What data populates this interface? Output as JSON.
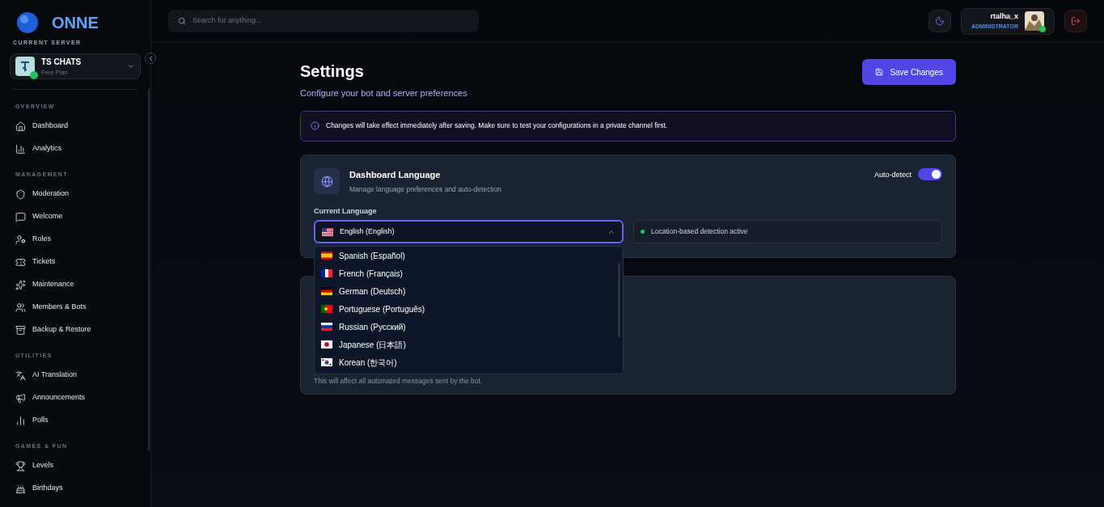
{
  "brand": {
    "name": "ONNE"
  },
  "server": {
    "section_label": "CURRENT SERVER",
    "name": "TS CHATS",
    "plan": "Free Plan",
    "online": true
  },
  "sidebar": {
    "sections": [
      {
        "label": "OVERVIEW",
        "items": [
          "Dashboard",
          "Analytics"
        ]
      },
      {
        "label": "MANAGEMENT",
        "items": [
          "Moderation",
          "Welcome",
          "Roles",
          "Tickets",
          "Maintenance",
          "Members & Bots",
          "Backup & Restore"
        ]
      },
      {
        "label": "UTILITIES",
        "items": [
          "AI Translation",
          "Announcements",
          "Polls"
        ]
      },
      {
        "label": "GAMES & FUN",
        "items": [
          "Levels",
          "Birthdays"
        ]
      }
    ]
  },
  "search": {
    "placeholder": "Search for anything..."
  },
  "user": {
    "name": "rtalha_x",
    "role": "ADMINISTRATOR",
    "online": true
  },
  "page": {
    "title": "Settings",
    "subtitle": "Configure your bot and server preferences",
    "save_button": "Save Changes"
  },
  "notice": "Changes will take effect immediately after saving. Make sure to test your configurations in a private channel first.",
  "language_card": {
    "title": "Dashboard Language",
    "subtitle": "Manage language preferences and auto-detection",
    "auto_detect": {
      "label": "Auto-detect",
      "on": true
    },
    "field_label": "Current Language",
    "value": {
      "kind": "us",
      "label": "English (English)"
    },
    "expanded": true,
    "detection": "Location-based detection active",
    "options": [
      {
        "kind": "es",
        "label": "Spanish (Español)",
        "selected": false
      },
      {
        "kind": "fr",
        "label": "French (Français)",
        "selected": false
      },
      {
        "kind": "de",
        "label": "German (Deutsch)",
        "selected": false
      },
      {
        "kind": "pt",
        "label": "Portuguese (Português)",
        "selected": false
      },
      {
        "kind": "ru",
        "label": "Russian (Русский)",
        "selected": false
      },
      {
        "kind": "jp",
        "label": "Japanese (日本語)",
        "selected": false
      },
      {
        "kind": "kr",
        "label": "Korean (한국어)",
        "selected": false
      }
    ]
  },
  "second_card": {
    "note": "This will affect all automated messages sent by the bot."
  }
}
